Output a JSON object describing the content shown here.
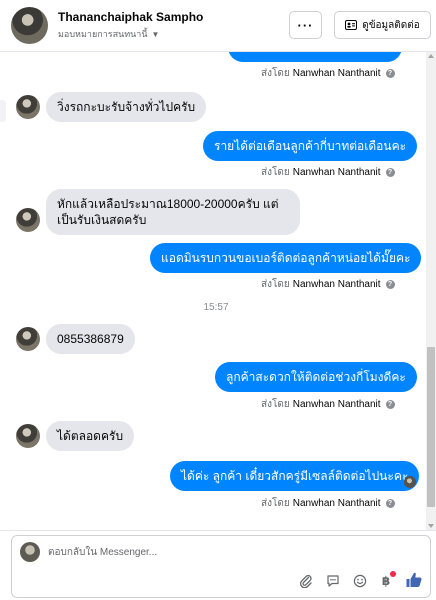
{
  "header": {
    "contact_name": "Thananchaiphak Sampho",
    "assignee_label": "มอบหมายการสนทนานี้",
    "more_label": "···",
    "contact_button_label": "ดูข้อมูลติดต่อ"
  },
  "thread": {
    "messages": [
      {
        "direction": "incoming",
        "text": "วิ่งรถกะบะรับจ้างทั่วไปครับ"
      },
      {
        "direction": "outgoing",
        "text": "รายได้ต่อเดือนลูกค้ากี่บาทต่อเดือนคะ"
      },
      {
        "direction": "incoming",
        "text": "หักแล้วเหลือประมาณ18000-20000ครับ แต่เป็นรับเงินสดครับ"
      },
      {
        "direction": "outgoing",
        "text": "แอดมินรบกวนขอเบอร์ติดต่อลูกค้าหน่อยได้มั๊ยคะ"
      },
      {
        "direction": "incoming",
        "text": "0855386879"
      },
      {
        "direction": "outgoing",
        "text": "ลูกค้าสะดวกให้ติดต่อช่วงกี่โมงดีคะ"
      },
      {
        "direction": "incoming",
        "text": "ได้ตลอดครับ"
      },
      {
        "direction": "outgoing",
        "text": "ได้ค่ะ ลูกค้า เดี๋ยวสักครู่มีเซลล์ติดต่อไปนะคะ"
      }
    ],
    "sent_by_prefix": "ส่งโดย",
    "sent_by_name": "Nanwhan Nanthanit",
    "timestamp": "15:57"
  },
  "composer": {
    "placeholder": "ตอบกลับใน Messenger...",
    "tools": [
      "attachment-icon",
      "saved-replies-icon",
      "emoji-icon",
      "payment-icon",
      "like-icon"
    ]
  },
  "colors": {
    "outgoing_bubble": "#0084ff",
    "incoming_bubble": "#e4e6eb",
    "like_icon": "#4267b2"
  }
}
